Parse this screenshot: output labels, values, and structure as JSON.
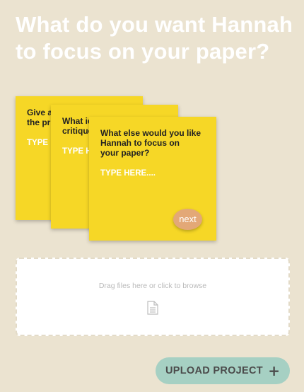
{
  "header": {
    "title": "What do you want Hannah to focus on your paper?"
  },
  "cards": [
    {
      "prompt": "Give a\nthe pr",
      "placeholder": "TYPE"
    },
    {
      "prompt": "What id\ncritique",
      "placeholder": "TYPE H"
    },
    {
      "prompt": "What else would you like\nHannah to focus on\nyour paper?",
      "placeholder": "TYPE HERE....",
      "next_label": "next"
    }
  ],
  "dropzone": {
    "text": "Drag files here or click to browse",
    "icon": "file-icon"
  },
  "upload": {
    "label": "UPLOAD PROJECT",
    "icon": "plus-icon"
  },
  "colors": {
    "background": "#ebe3d0",
    "card": "#f6d726",
    "next_button": "#e3a877",
    "upload_button": "#a6d0c3"
  }
}
